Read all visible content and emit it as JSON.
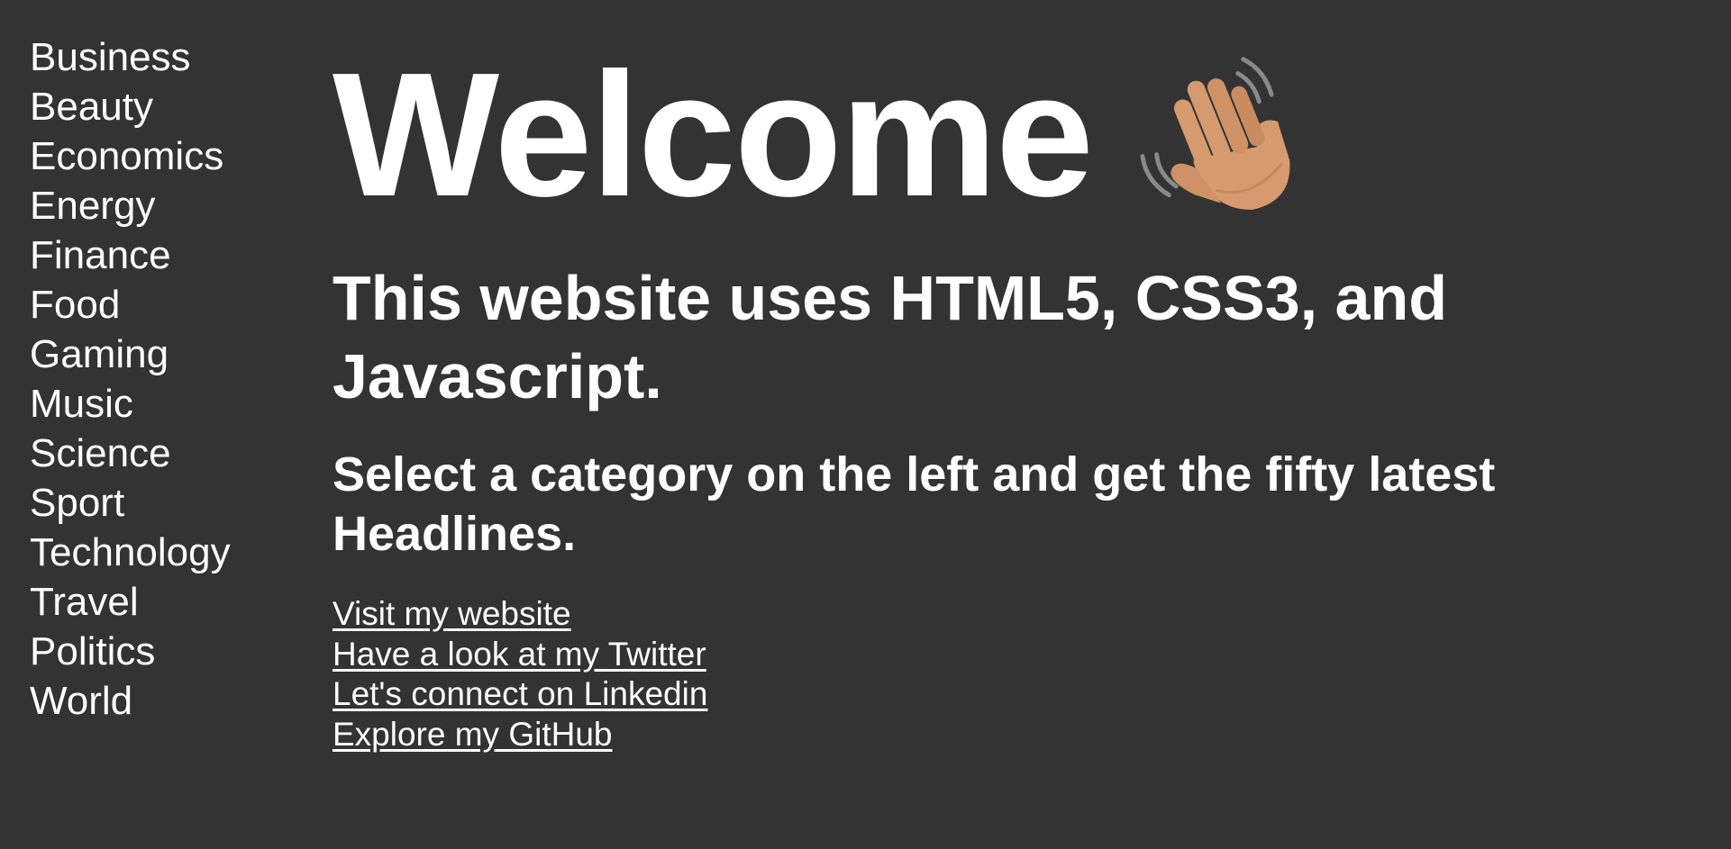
{
  "sidebar": {
    "items": [
      {
        "label": "Business"
      },
      {
        "label": "Beauty"
      },
      {
        "label": "Economics"
      },
      {
        "label": "Energy"
      },
      {
        "label": "Finance"
      },
      {
        "label": "Food"
      },
      {
        "label": "Gaming"
      },
      {
        "label": "Music"
      },
      {
        "label": "Science"
      },
      {
        "label": "Sport"
      },
      {
        "label": "Technology"
      },
      {
        "label": "Travel"
      },
      {
        "label": "Politics"
      },
      {
        "label": "World"
      }
    ]
  },
  "main": {
    "title": "Welcome",
    "title_icon": "waving-hand-icon",
    "tech_line": "This website uses HTML5, CSS3, and Javascript.",
    "instruction": "Select a category on the left and get the fifty latest Headlines.",
    "links": [
      {
        "label": "Visit my website"
      },
      {
        "label": "Have a look at my Twitter"
      },
      {
        "label": "Let's connect on Linkedin"
      },
      {
        "label": "Explore my GitHub"
      }
    ]
  },
  "colors": {
    "background": "#333333",
    "text": "#ffffff",
    "hand_skin": "#d59a6e"
  }
}
